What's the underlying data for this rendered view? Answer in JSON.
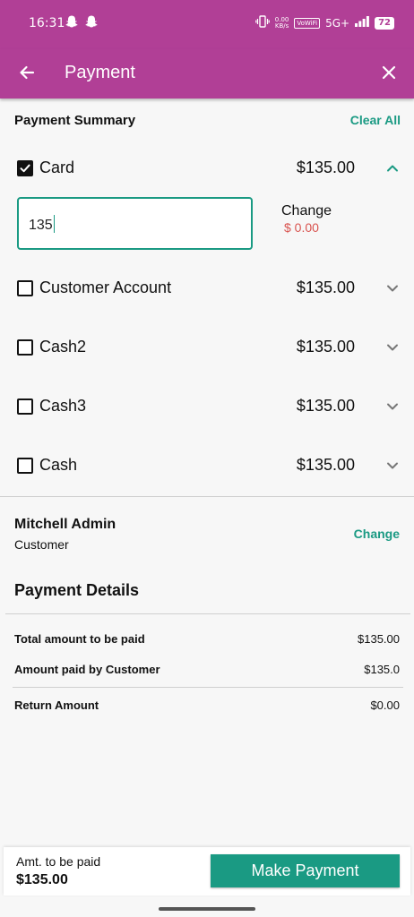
{
  "status_bar": {
    "time": "16:31",
    "net_speed_value": "0.00",
    "net_speed_unit": "KB/s",
    "volte": "VoWiFi",
    "network": "5G+",
    "battery": "72"
  },
  "app_bar": {
    "title": "Payment"
  },
  "summary": {
    "title": "Payment Summary",
    "clear_all": "Clear All"
  },
  "payment_methods": [
    {
      "label": "Card",
      "amount": "$135.00",
      "checked": true,
      "expanded": true
    },
    {
      "label": "Customer Account",
      "amount": "$135.00",
      "checked": false,
      "expanded": false
    },
    {
      "label": "Cash2",
      "amount": "$135.00",
      "checked": false,
      "expanded": false
    },
    {
      "label": "Cash3",
      "amount": "$135.00",
      "checked": false,
      "expanded": false
    },
    {
      "label": "Cash",
      "amount": "$135.00",
      "checked": false,
      "expanded": false
    }
  ],
  "card_entry": {
    "value": "135",
    "change_label": "Change",
    "change_value": "$ 0.00"
  },
  "customer": {
    "name": "Mitchell Admin",
    "role": "Customer",
    "change_label": "Change"
  },
  "payment_details": {
    "title": "Payment Details",
    "rows": [
      {
        "label": "Total amount to be paid",
        "value": "$135.00"
      },
      {
        "label": "Amount paid by Customer",
        "value": "$135.0"
      },
      {
        "label": "Return Amount",
        "value": "$0.00"
      }
    ]
  },
  "bottom_bar": {
    "amount_label": "Amt. to be paid",
    "amount_value": "$135.00",
    "button_label": "Make Payment"
  },
  "colors": {
    "app_bar": "#b13f96",
    "accent": "#1a9a83",
    "change_value": "#d9534f",
    "background": "#f7f7f7"
  }
}
